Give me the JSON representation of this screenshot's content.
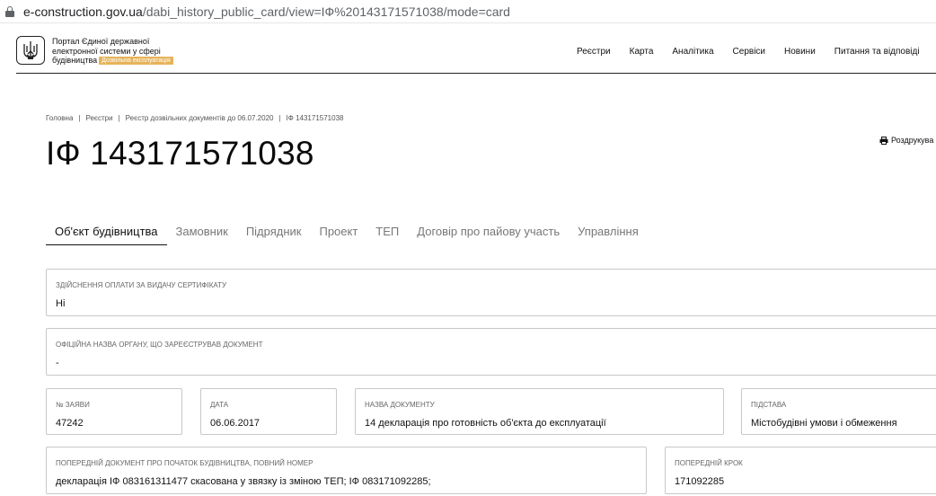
{
  "browser": {
    "url_host": "e-construction.gov.ua",
    "url_path": "/dabi_history_public_card/view=IФ%20143171571038/mode=card"
  },
  "header": {
    "logo_icon": "trident-icon",
    "logo_line1": "Портал Єдиної державної",
    "logo_line2": "електронної системи у сфері",
    "logo_line3": "будівництва",
    "badge": "Дозвільна експлуатація",
    "nav": [
      "Реєстри",
      "Карта",
      "Аналітика",
      "Сервіси",
      "Новини",
      "Питання та відповіді"
    ]
  },
  "breadcrumb": [
    "Головна",
    "Реєстри",
    "Реєстр дозвільних документів до 06.07.2020",
    "IФ 143171571038"
  ],
  "page_title": "IФ 143171571038",
  "print_label": "Роздрукува",
  "tabs": [
    "Об'єкт будівництва",
    "Замовник",
    "Підрядник",
    "Проект",
    "ТЕП",
    "Договір про пайову участь",
    "Управління"
  ],
  "active_tab": 0,
  "fields": {
    "payment": {
      "label": "Здійснення оплати за видачу сертифікату",
      "value": "Ні"
    },
    "official_name": {
      "label": "Офіційна назва органу, що зареєстрував документ",
      "value": "-"
    },
    "app_no": {
      "label": "№ заяви",
      "value": "47242"
    },
    "date": {
      "label": "Дата",
      "value": "06.06.2017"
    },
    "doc_name": {
      "label": "Назва документу",
      "value": "14 декларація про готовність об'єкта до експлуатації"
    },
    "basis": {
      "label": "Підстава",
      "value": "Містобудівні умови і обмеження"
    },
    "prev_doc": {
      "label": "Попередній документ про початок будівництва, повний номер",
      "value": "декларація IФ 083161311477 скасована у звязку із зміною ТЕП; IФ 083171092285;"
    },
    "prev_step": {
      "label": "Попередній крок",
      "value": "171092285"
    }
  }
}
